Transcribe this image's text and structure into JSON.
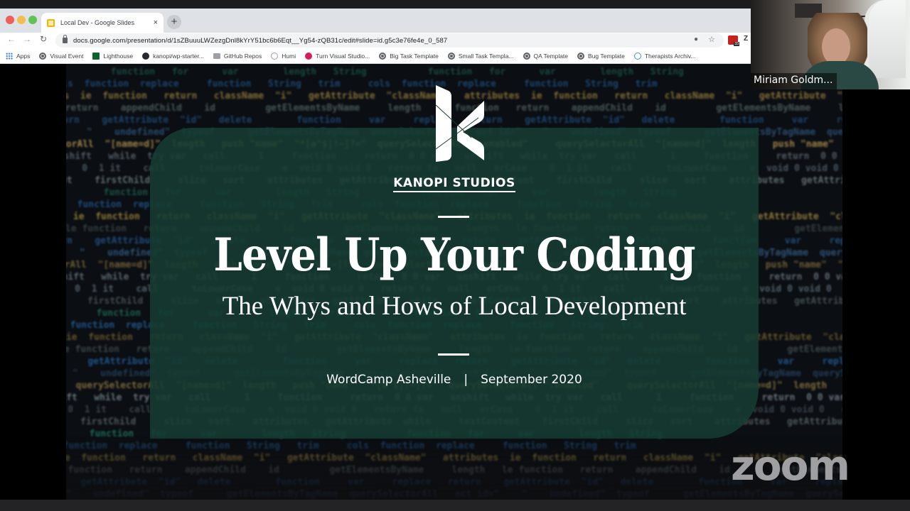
{
  "browser": {
    "tab_title": "Local Dev - Google Slides",
    "tab_close": "×",
    "new_tab": "+",
    "nav": {
      "back": "←",
      "forward": "→",
      "reload": "C"
    },
    "url": "docs.google.com/presentation/d/1sZBuuuLWZezgDnl8kYrY51bc6b6Eqt__Yg54-zQB31c/edit#slide=id.g5c3e76fe4e_0_587",
    "mic_icon": "🎤",
    "star_icon": "☆",
    "extension_badge": "33",
    "extension_partial": "Z",
    "bookmarks": [
      {
        "label": "Apps",
        "icon": "apps-grid-icon"
      },
      {
        "label": "Visual Event",
        "icon": "globe-icon"
      },
      {
        "label": "Lighthouse",
        "icon": "lighthouse-icon"
      },
      {
        "label": "kanopi/wp-starter...",
        "icon": "github-icon"
      },
      {
        "label": "GitHub Repos",
        "icon": "folder-icon"
      },
      {
        "label": "Humi",
        "icon": "humi-icon"
      },
      {
        "label": "Turn Visual Studio...",
        "icon": "turn-icon"
      },
      {
        "label": "Big Task Template",
        "icon": "globe-icon"
      },
      {
        "label": "Small Task Templa...",
        "icon": "globe-icon"
      },
      {
        "label": "QA Template",
        "icon": "globe-icon"
      },
      {
        "label": "Bug Template",
        "icon": "globe-icon"
      },
      {
        "label": "Therapists Archiv...",
        "icon": "info-icon"
      }
    ]
  },
  "slide": {
    "brand": "KANOPI STUDIOS",
    "title": "Level Up Your Coding",
    "subtitle": "The Whys and Hows of Local Development",
    "event": "WordCamp Asheville",
    "separator": "|",
    "date": "September 2020",
    "code_lines": [
      {
        "text": "        function   for      var        length   String",
        "color": "#2a8f7a"
      },
      {
        "text": "  cols  function  replace     function   String   trim",
        "color": "#2b6fb5"
      },
      {
        "text": "attributes  ie  function   return   className  \"i\"   getAttribute  \"className\"",
        "color": "#b9994b"
      },
      {
        "text": "le function   return    appendChild    id         getElementsByName     length",
        "color": "#5a6a6a"
      },
      {
        "text": "return    getAttribute  \"id\"   delete        function     var     replace",
        "color": "#2b6fb5"
      },
      {
        "text": "ect id=\"    \"    undefined\"  typeof      getElementsByTagName  querySelectorAll",
        "color": "#3a6a9a"
      },
      {
        "text": "  querySelectorAll  \"[name=d]\"  length   push \"name\"  \"*[a^$|!~]?=\"  querySelectorAll \":enabled\"",
        "color": "#c4a45a"
      },
      {
        "text": "unshift   while  try var   call      1     function     return  0 0 var",
        "color": "#8a9aa8"
      },
      {
        "text": "erCase    0  1 it    call      toLowerCase    e  void 0 void 0   return fa   null",
        "color": "#6a7a8a"
      },
      {
        "text": "  textContent    firstChild     slice   sort    attributes   getAttribute  while",
        "color": "#7a8a8a"
      }
    ]
  },
  "participant": {
    "name": "Miriam Goldm..."
  },
  "watermark": "zoom"
}
